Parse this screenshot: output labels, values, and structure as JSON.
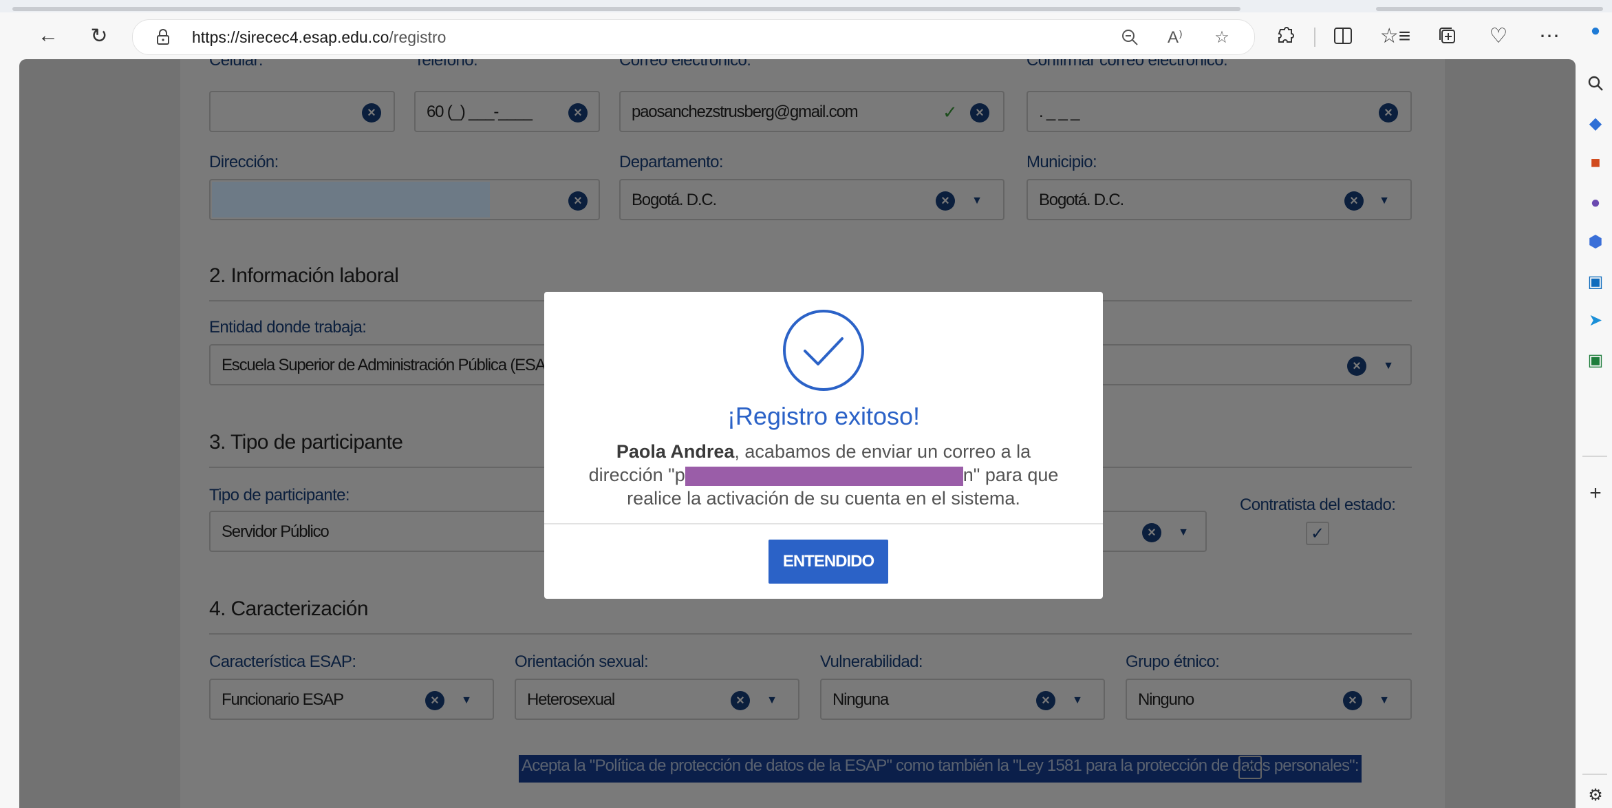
{
  "browser": {
    "url_host": "https://sirecec4.esap.edu.co",
    "url_path": "/registro",
    "icons": {
      "back": "back-arrow-icon",
      "refresh": "refresh-icon",
      "lock": "lock-icon",
      "zoom": "zoom-out-icon",
      "read_aloud": "read-aloud-icon",
      "favorite": "favorite-star-icon",
      "extensions": "extensions-icon",
      "split": "split-screen-icon",
      "favorites": "favorites-list-icon",
      "collections": "collections-icon",
      "health": "browser-essentials-icon",
      "more": "more-icon"
    }
  },
  "sidebar": {
    "items": [
      "copilot-icon",
      "search-icon",
      "shopping-tag-icon",
      "tools-icon",
      "people-icon",
      "office-icon",
      "outlook-icon",
      "send-icon",
      "excel-icon",
      "add-icon",
      "settings-icon"
    ]
  },
  "form": {
    "row1": {
      "cellular_label": "Celular:",
      "phone_label": "Teléfono:",
      "phone_value": "60 (_) ___-____",
      "email_label": "Correo electrónico:",
      "email_value": "paosanchezstrusberg@gmail.com",
      "confirm_email_label": "Confirmar correo electrónico:",
      "confirm_email_value": ".                    _ _ _"
    },
    "address_label": "Dirección:",
    "department_label": "Departamento:",
    "department_value": "Bogotá. D.C.",
    "municipality_label": "Municipio:",
    "municipality_value": "Bogotá. D.C.",
    "section2_title": "2. Información laboral",
    "entity_label": "Entidad donde trabaja:",
    "entity_value": "Escuela Superior de Administración Pública (ESA",
    "section3_title": "3. Tipo de participante",
    "participant_label": "Tipo de participante:",
    "participant_value": "Servidor Público",
    "contractor_label": "Contratista del estado:",
    "section4_title": "4. Caracterización",
    "esap_char_label": "Característica ESAP:",
    "esap_char_value": "Funcionario ESAP",
    "orientation_label": "Orientación sexual:",
    "orientation_value": "Heterosexual",
    "vulnerability_label": "Vulnerabilidad:",
    "vulnerability_value": "Ninguna",
    "ethnic_label": "Grupo étnico:",
    "ethnic_value": "Ninguno",
    "consent_text": "Acepta la \"Política de protección de datos de la ESAP\" como también la \"Ley 1581 para la protección de datos personales\""
  },
  "modal": {
    "title": "¡Registro exitoso!",
    "name": "Paola Andrea",
    "body_1": ", acabamos de enviar un correo a la dirección \"p",
    "body_2": "n\" para que realice la activación de su cuenta en el sistema.",
    "button_label": "ENTENDIDO"
  },
  "colors": {
    "accent": "#2b62c7",
    "overlay": "#727272",
    "label_dark": "#0b1f3d"
  }
}
